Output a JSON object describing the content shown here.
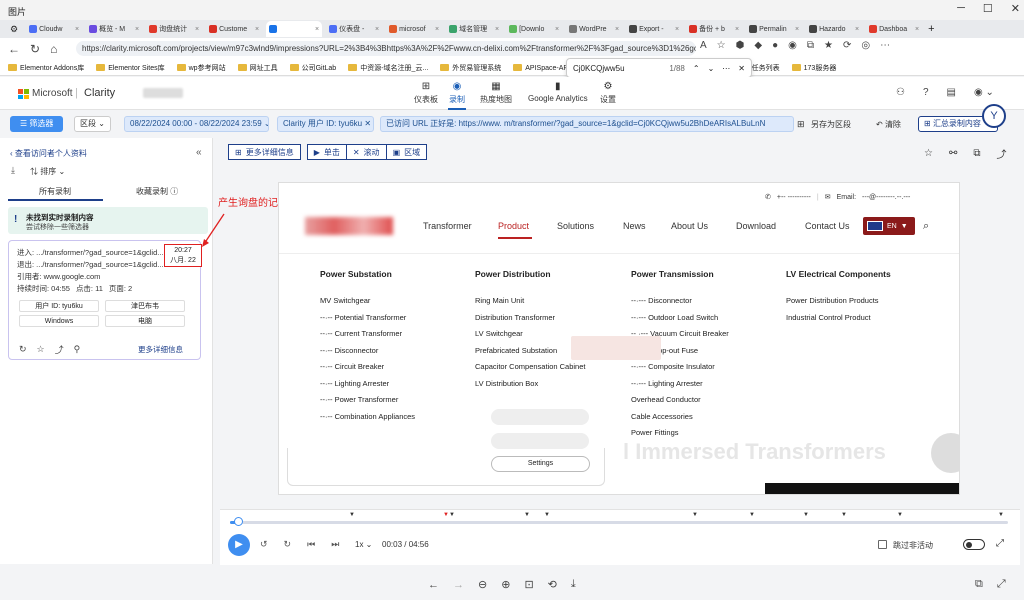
{
  "window": {
    "title": "图片"
  },
  "tabs": [
    {
      "label": "Cloudw",
      "color": "#4c6ef5"
    },
    {
      "label": "概览 - M",
      "color": "#6a4ce0"
    },
    {
      "label": "询盘统计",
      "color": "#e0392b"
    },
    {
      "label": "Custome",
      "color": "#d93025"
    },
    {
      "label": "",
      "color": "#1a73e8",
      "active": true
    },
    {
      "label": "仪表盘 -",
      "color": "#4c6ef5"
    },
    {
      "label": "microsof",
      "color": "#e05a2b"
    },
    {
      "label": "域名管理",
      "color": "#3aa36b"
    },
    {
      "label": "[Downlo",
      "color": "#5cb85c"
    },
    {
      "label": "WordPre",
      "color": "#777"
    },
    {
      "label": "Export -",
      "color": "#444"
    },
    {
      "label": "备份 + b",
      "color": "#d93025"
    },
    {
      "label": "Permalin",
      "color": "#444"
    },
    {
      "label": "Hazardo",
      "color": "#444"
    },
    {
      "label": "Dashboa",
      "color": "#e0392b"
    }
  ],
  "address": {
    "url": "https://clarity.microsoft.com/projects/view/m97c3wlnd9/impressions?URL=2%3B4%3Bhttps%3A%2F%2Fwww.cn-delixi.com%2Ftransformer%2F%3Fgad_source%3D1%26gclid%3DCj0K..."
  },
  "findbar": {
    "query": "Cj0KCQjww5u",
    "count": "1/88"
  },
  "bookmarks": [
    "Elementor Addons库",
    "Elementor Sites库",
    "wp参考网站",
    "网址工具",
    "公司GitLab",
    "中资源-域名注册_云...",
    "外贸易管理系统",
    "APISpace-API数据...",
    "宝塔L",
    "gle 翻译",
    "Google",
    "任务列表",
    "173服务器"
  ],
  "clarity": {
    "brand": "Microsoft",
    "product": "Clarity",
    "menu": [
      {
        "label": "仪表板",
        "icon": "dashboard-icon"
      },
      {
        "label": "录制",
        "icon": "record-icon",
        "selected": true
      },
      {
        "label": "热度地图",
        "icon": "heatmap-icon"
      },
      {
        "label": "Google Analytics",
        "icon": "ga-icon"
      },
      {
        "label": "设置",
        "icon": "settings-icon"
      }
    ]
  },
  "filters": {
    "filter_btn": "筛选器",
    "segment": "区段",
    "date_range": "08/22/2024 00:00 - 08/22/2024 23:59",
    "user_id": "Clarity 用户 ID: tyu6ku",
    "visited_url": "已访问 URL 正好是: https://www.                 m/transformer/?gad_source=1&gclid=Cj0KCQjww5u2BhDeARIsALBuLnN",
    "save_segment": "另存为区段",
    "clear": "清除",
    "summarize": "汇总录制内容"
  },
  "left": {
    "back": "查看访问者个人资料",
    "sort": "排序",
    "tabs": [
      "所有录制",
      "收藏录制"
    ],
    "alert_title": "未找到实时录制内容",
    "alert_sub": "尝试移除一些筛选器",
    "card": {
      "entry": "进入: .../transformer/?gad_source=1&gclid...",
      "exit": "退出: .../transformer/?gad_source=1&gclid...",
      "referrer": "引用者: www.google.com",
      "duration": "持续时间: 04:55",
      "clicks": "点击: 11",
      "pages": "页面: 2",
      "time": "20:27",
      "date": "八月. 22",
      "chips": [
        "用户 ID: tyu6ku",
        "津巴布韦",
        "Windows",
        "电脑"
      ],
      "more": "更多详细信息"
    }
  },
  "annotation": "产生询盘的记录时间",
  "toolbar": {
    "more": "更多详细信息",
    "click": "单击",
    "scroll": "滚动",
    "area": "区域"
  },
  "site": {
    "phone": "+-- ----------",
    "email_label": "Email:",
    "email": "---@--------.--.---",
    "nav": [
      "Transformer",
      "Product",
      "Solutions",
      "News",
      "About Us",
      "Download",
      "Contact Us"
    ],
    "lang": "EN",
    "columns": [
      {
        "title": "Power Substation",
        "items": [
          "MV Switchgear",
          "--·-- Potential Transformer",
          "--·-- Current Transformer",
          "--·-- Disconnector",
          "--·-- Circuit Breaker",
          "--·-- Lighting Arrester",
          "--·-- Power Transformer",
          "--·-- Combination Appliances"
        ]
      },
      {
        "title": "Power Distribution",
        "items": [
          "Ring Main Unit",
          "Distribution Transformer",
          "LV Switchgear",
          "Prefabricated Substation",
          "Capacitor Compensation Cabinet",
          "LV Distribution Box"
        ]
      },
      {
        "title": "Power Transmission",
        "items": [
          "--·--- Disconnector",
          "--·--- Outdoor Load Switch",
          "-- ·--- Vacuum Circuit Breaker",
          "-- ·--- Drop-out Fuse",
          "--·--- Composite Insulator",
          "--·--- Lighting Arrester",
          "Overhead Conductor",
          "Cable Accessories",
          "Power Fittings"
        ]
      },
      {
        "title": "LV Electrical Components",
        "items": [
          "Power Distribution Products",
          "Industrial Control Product"
        ]
      }
    ],
    "settings_btn": "Settings",
    "banner": "l Immersed Transformers"
  },
  "player": {
    "speed": "1x",
    "time": "00:03 / 04:56",
    "skip": "跳过非活动"
  },
  "colors": {
    "accent": "#3f8ef0",
    "annotation": "#e02020"
  }
}
